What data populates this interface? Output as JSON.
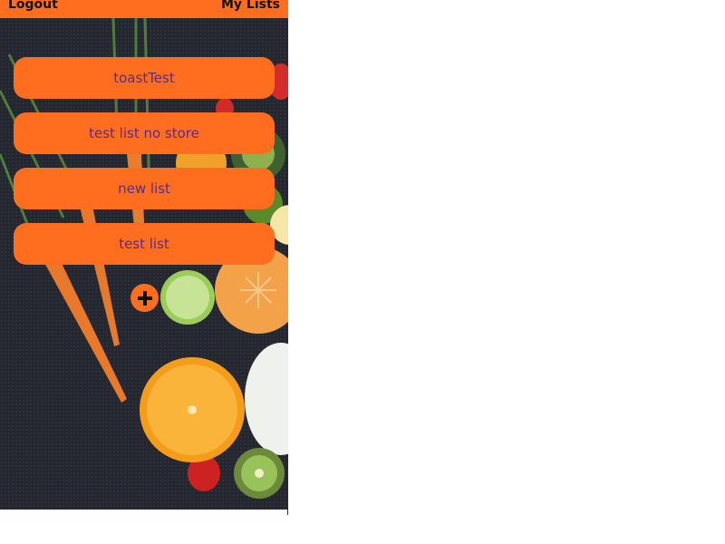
{
  "topbar": {
    "logout_label": "Logout",
    "title": "My Lists"
  },
  "lists": [
    {
      "label": "toastTest"
    },
    {
      "label": "test list no store"
    },
    {
      "label": "new list"
    },
    {
      "label": "test list"
    }
  ],
  "add_button_icon": "plus-icon",
  "colors": {
    "accent": "#ff6e1f",
    "button_text": "#5a2a8a",
    "background": "#23252f"
  }
}
